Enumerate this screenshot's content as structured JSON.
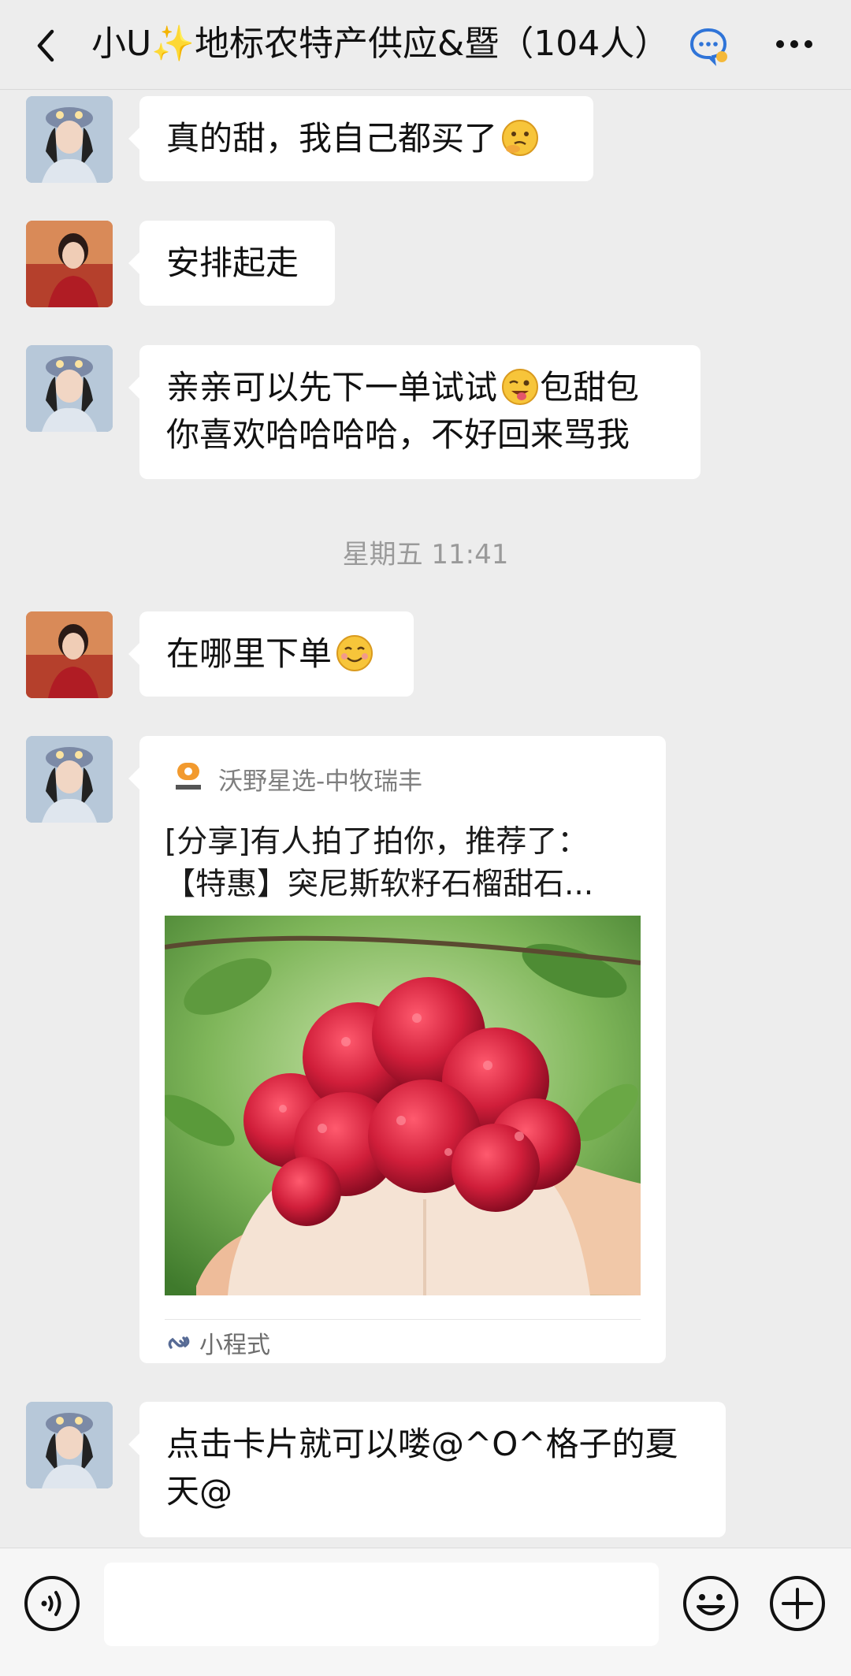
{
  "header": {
    "title": "小U✨地标农特产供应&暨（104人）",
    "back_icon": "chevron-left-icon",
    "chat_icon": "chat-bubble-icon",
    "more_icon": "more-dots-icon"
  },
  "messages": [
    {
      "sender": "group-member-a",
      "text_lines": [
        "真的甜，我自己都买了"
      ],
      "emoji": "thinking-face-emoji"
    },
    {
      "sender": "group-member-b",
      "text_lines": [
        "安排起走"
      ]
    },
    {
      "sender": "group-member-a",
      "text_lines": [
        "亲亲可以先下一单试试",
        "你喜欢哈哈哈哈，不好回来骂我"
      ],
      "inline_emoji": "winking-tongue-emoji",
      "inline_after": "包甜包"
    },
    {
      "sender": "group-member-b",
      "text_lines": [
        "在哪里下单"
      ],
      "emoji": "smiling-face-emoji"
    },
    {
      "sender": "group-member-a",
      "text_lines": [
        "点击卡片就可以喽@^O^格子的夏",
        "天@"
      ]
    }
  ],
  "timestamp": "星期五 11:41",
  "card": {
    "source_name": "沃野星选-中牧瑞丰",
    "title_line1": "[分享]有人拍了拍你，推荐了：",
    "title_line2": "【特惠】突尼斯软籽石榴甜石...",
    "footer_label": "小程式",
    "image": "pomegranate-photo",
    "logo_text": "沃野星选"
  },
  "bottom_bar": {
    "voice_icon": "voice-icon",
    "emoji_icon": "emoji-icon",
    "plus_icon": "plus-icon"
  },
  "colors": {
    "background": "#ededed",
    "bubble": "#ffffff",
    "timestamp": "#9a9a9a",
    "link_icon": "#576b95"
  }
}
